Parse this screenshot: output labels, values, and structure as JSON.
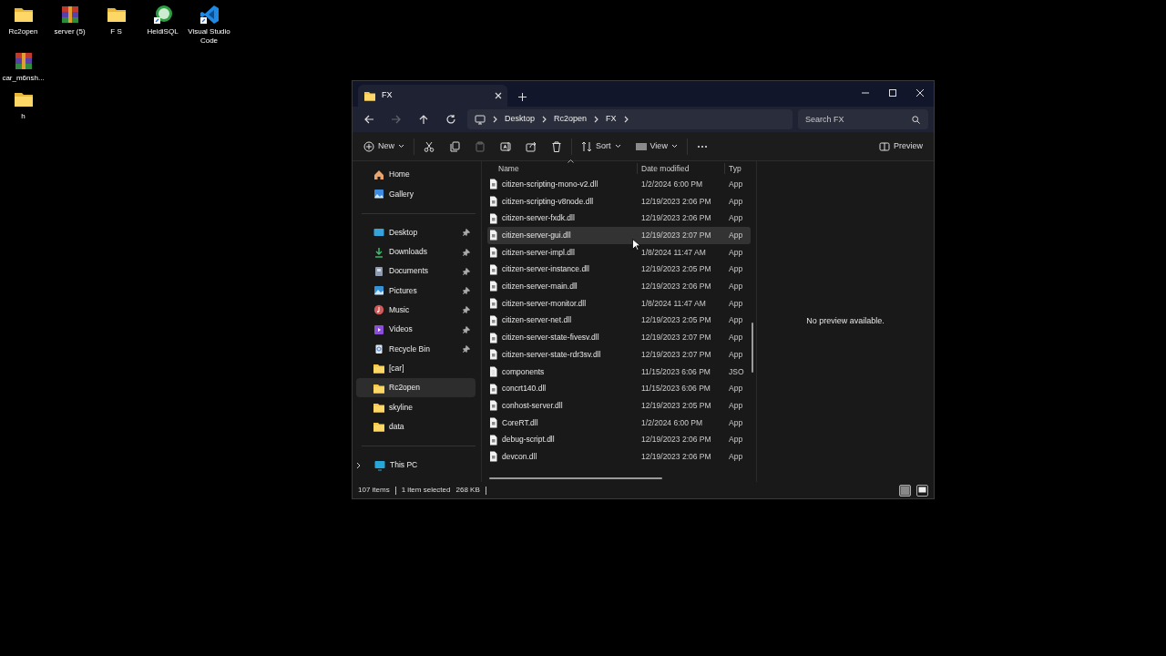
{
  "desktop_icons": [
    {
      "label": "Rc2open",
      "kind": "folder"
    },
    {
      "label": "server (5)",
      "kind": "archive"
    },
    {
      "label": "F S",
      "kind": "folder"
    },
    {
      "label": "HeidiSQL",
      "kind": "database-app"
    },
    {
      "label": "Visual Studio Code",
      "kind": "editor-app"
    },
    {
      "label": "car_m6nsh...",
      "kind": "archive"
    },
    {
      "label": "h",
      "kind": "folder"
    }
  ],
  "window": {
    "tab": {
      "title": "FX"
    },
    "nav": {
      "forward_disabled": true
    },
    "breadcrumb": [
      "Desktop",
      "Rc2open",
      "FX"
    ],
    "search": {
      "placeholder": "Search FX"
    },
    "toolbar": {
      "new": "New",
      "sort": "Sort",
      "view": "View",
      "preview": "Preview",
      "paste_disabled": true
    },
    "sidebar": {
      "groups": [
        [
          {
            "label": "Home",
            "kind": "home",
            "selected": false
          },
          {
            "label": "Gallery",
            "kind": "gallery",
            "selected": false
          }
        ],
        [
          {
            "label": "Desktop",
            "kind": "desktop",
            "pinned": true,
            "selected": false
          },
          {
            "label": "Downloads",
            "kind": "downloads",
            "pinned": true,
            "selected": false
          },
          {
            "label": "Documents",
            "kind": "documents",
            "pinned": true,
            "selected": false
          },
          {
            "label": "Pictures",
            "kind": "pictures",
            "pinned": true,
            "selected": false
          },
          {
            "label": "Music",
            "kind": "music",
            "pinned": true,
            "selected": false
          },
          {
            "label": "Videos",
            "kind": "videos",
            "pinned": true,
            "selected": false
          },
          {
            "label": "Recycle Bin",
            "kind": "recycle",
            "pinned": true,
            "selected": false
          },
          {
            "label": "[car]",
            "kind": "folder",
            "pinned": false,
            "selected": false
          },
          {
            "label": "Rc2open",
            "kind": "folder",
            "pinned": false,
            "selected": true
          },
          {
            "label": "skyline",
            "kind": "folder",
            "pinned": false,
            "selected": false
          },
          {
            "label": "data",
            "kind": "folder",
            "pinned": false,
            "selected": false
          }
        ],
        [
          {
            "label": "This PC",
            "kind": "pc",
            "expanded": false,
            "selected": false
          }
        ]
      ]
    },
    "columns": [
      "Name",
      "Date modified",
      "Typ"
    ],
    "rows": [
      {
        "name": "citizen-scripting-mono-v2.dll",
        "date": "1/2/2024 6:00 PM",
        "type": "App",
        "kind": "dll",
        "selected": false
      },
      {
        "name": "citizen-scripting-v8node.dll",
        "date": "12/19/2023 2:06 PM",
        "type": "App",
        "kind": "dll",
        "selected": false
      },
      {
        "name": "citizen-server-fxdk.dll",
        "date": "12/19/2023 2:06 PM",
        "type": "App",
        "kind": "dll",
        "selected": false
      },
      {
        "name": "citizen-server-gui.dll",
        "date": "12/19/2023 2:07 PM",
        "type": "App",
        "kind": "dll",
        "selected": true
      },
      {
        "name": "citizen-server-impl.dll",
        "date": "1/8/2024 11:47 AM",
        "type": "App",
        "kind": "dll",
        "selected": false
      },
      {
        "name": "citizen-server-instance.dll",
        "date": "12/19/2023 2:05 PM",
        "type": "App",
        "kind": "dll",
        "selected": false
      },
      {
        "name": "citizen-server-main.dll",
        "date": "12/19/2023 2:06 PM",
        "type": "App",
        "kind": "dll",
        "selected": false
      },
      {
        "name": "citizen-server-monitor.dll",
        "date": "1/8/2024 11:47 AM",
        "type": "App",
        "kind": "dll",
        "selected": false
      },
      {
        "name": "citizen-server-net.dll",
        "date": "12/19/2023 2:05 PM",
        "type": "App",
        "kind": "dll",
        "selected": false
      },
      {
        "name": "citizen-server-state-fivesv.dll",
        "date": "12/19/2023 2:07 PM",
        "type": "App",
        "kind": "dll",
        "selected": false
      },
      {
        "name": "citizen-server-state-rdr3sv.dll",
        "date": "12/19/2023 2:07 PM",
        "type": "App",
        "kind": "dll",
        "selected": false
      },
      {
        "name": "components",
        "date": "11/15/2023 6:06 PM",
        "type": "JSO",
        "kind": "json",
        "selected": false
      },
      {
        "name": "concrt140.dll",
        "date": "11/15/2023 6:06 PM",
        "type": "App",
        "kind": "dll",
        "selected": false
      },
      {
        "name": "conhost-server.dll",
        "date": "12/19/2023 2:05 PM",
        "type": "App",
        "kind": "dll",
        "selected": false
      },
      {
        "name": "CoreRT.dll",
        "date": "1/2/2024 6:00 PM",
        "type": "App",
        "kind": "dll",
        "selected": false
      },
      {
        "name": "debug-script.dll",
        "date": "12/19/2023 2:06 PM",
        "type": "App",
        "kind": "dll",
        "selected": false
      },
      {
        "name": "devcon.dll",
        "date": "12/19/2023 2:06 PM",
        "type": "App",
        "kind": "dll",
        "selected": false
      }
    ],
    "preview_message": "No preview available.",
    "status": {
      "items": "107 items",
      "selection": "1 item selected",
      "size": "268 KB"
    },
    "view_modes": [
      {
        "kind": "details",
        "selected": true
      },
      {
        "kind": "tiles",
        "selected": false
      }
    ]
  }
}
